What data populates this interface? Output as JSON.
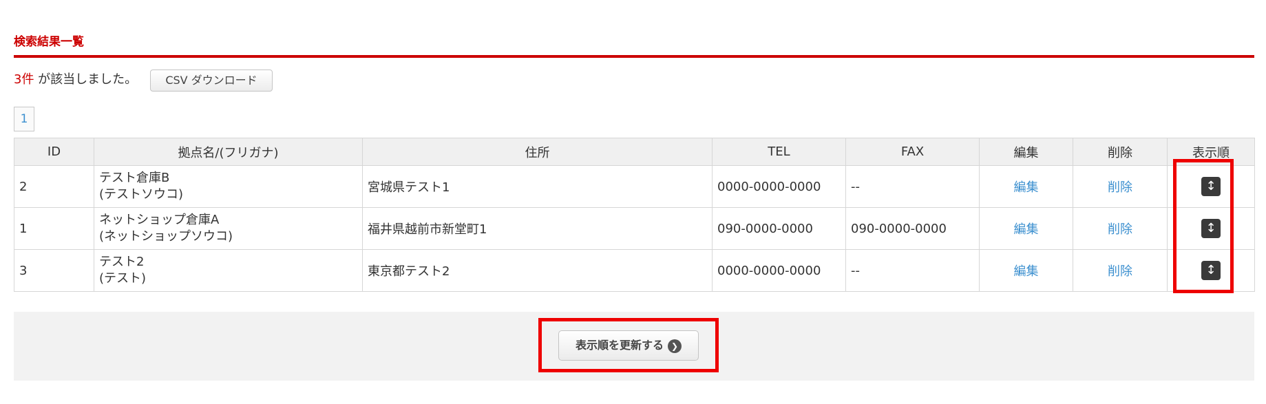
{
  "section": {
    "title": "検索結果一覧"
  },
  "summary": {
    "count": "3件",
    "text": " が該当しました。",
    "csv_button": "CSV ダウンロード"
  },
  "pagination": {
    "pages": [
      "1"
    ]
  },
  "table": {
    "headers": [
      "ID",
      "拠点名/(フリガナ)",
      "住所",
      "TEL",
      "FAX",
      "編集",
      "削除",
      "表示順"
    ],
    "rows": [
      {
        "id": "2",
        "name": "テスト倉庫B",
        "kana": "(テストソウコ)",
        "address": "宮城県テスト1",
        "tel": "0000-0000-0000",
        "fax": "--",
        "edit": "編集",
        "delete": "削除"
      },
      {
        "id": "1",
        "name": "ネットショップ倉庫A",
        "kana": "(ネットショップソウコ)",
        "address": "福井県越前市新堂町1",
        "tel": "090-0000-0000",
        "fax": "090-0000-0000",
        "edit": "編集",
        "delete": "削除"
      },
      {
        "id": "3",
        "name": "テスト2",
        "kana": "(テスト)",
        "address": "東京都テスト2",
        "tel": "0000-0000-0000",
        "fax": "--",
        "edit": "編集",
        "delete": "削除"
      }
    ]
  },
  "footer": {
    "update_button": "表示順を更新する"
  },
  "icons": {
    "sort_handle": "vertical-arrows-icon",
    "button_arrow": "chevron-right-circle-icon"
  },
  "colors": {
    "accent": "#cc0000",
    "link": "#3b8fcf",
    "highlight": "#ee0000"
  }
}
